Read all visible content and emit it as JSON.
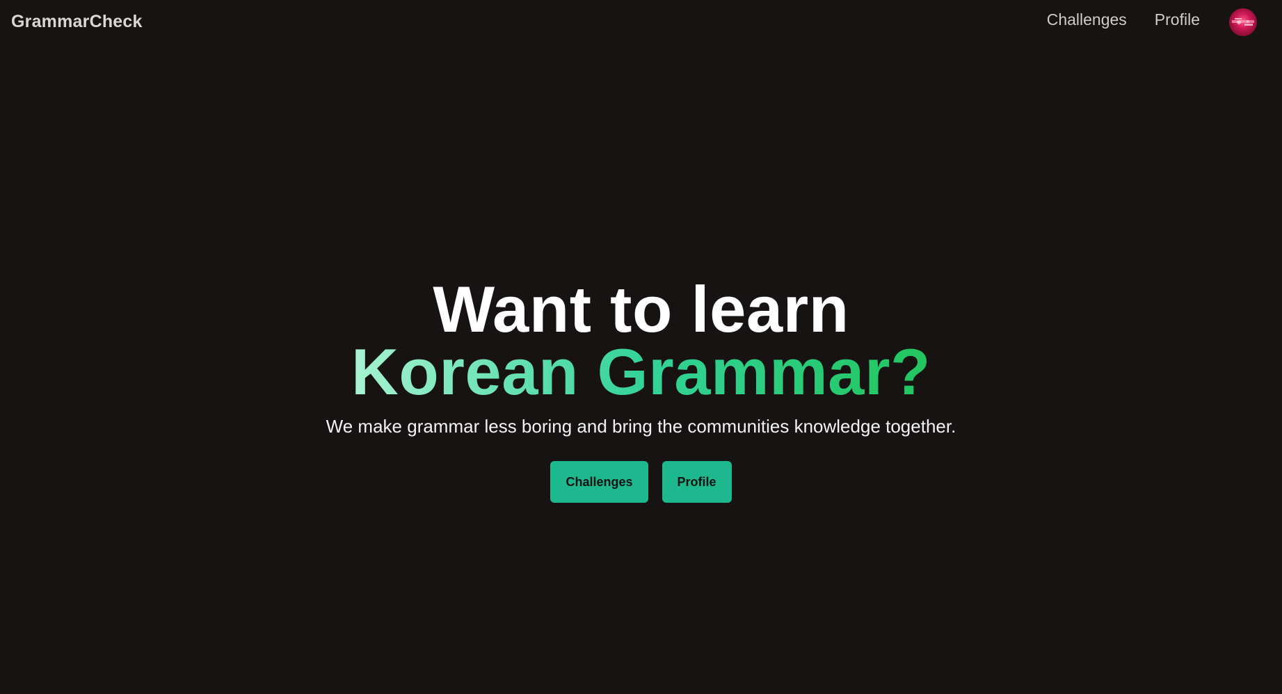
{
  "navbar": {
    "brand": "GrammarCheck",
    "links": [
      {
        "label": "Challenges"
      },
      {
        "label": "Profile"
      }
    ],
    "avatar_icon": "user-avatar-image"
  },
  "hero": {
    "headline_line1": "Want to learn",
    "headline_line2": "Korean Grammar?",
    "tagline": "We make grammar less boring and bring the communities knowledge together.",
    "buttons": [
      {
        "label": "Challenges"
      },
      {
        "label": "Profile"
      }
    ]
  },
  "colors": {
    "background": "#161312",
    "accent": "#1db88e",
    "gradient_start": "#a7f3d0",
    "gradient_end": "#22c55e"
  }
}
